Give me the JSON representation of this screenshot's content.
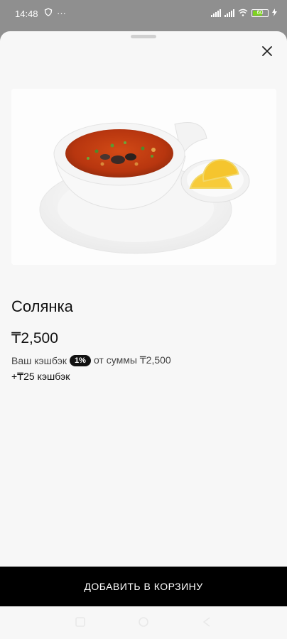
{
  "status_bar": {
    "time": "14:48",
    "dots": "···",
    "battery": "60"
  },
  "product": {
    "name": "Солянка",
    "price": "₸2,500",
    "cashback_prefix": "Ваш кэшбэк",
    "cashback_percent": "1%",
    "cashback_suffix": "от суммы ₸2,500",
    "cashback_bonus": "+₸25 кэшбэк"
  },
  "actions": {
    "add_to_cart": "ДОБАВИТЬ В КОРЗИНУ"
  },
  "colors": {
    "button_bg": "#000000",
    "sheet_bg": "#f7f7f7",
    "battery_accent": "#7ed321"
  },
  "icons": [
    "shield-icon",
    "signal-icon",
    "wifi-icon",
    "battery-icon",
    "close-icon",
    "nav-home-icon",
    "nav-recent-icon",
    "nav-back-icon"
  ]
}
